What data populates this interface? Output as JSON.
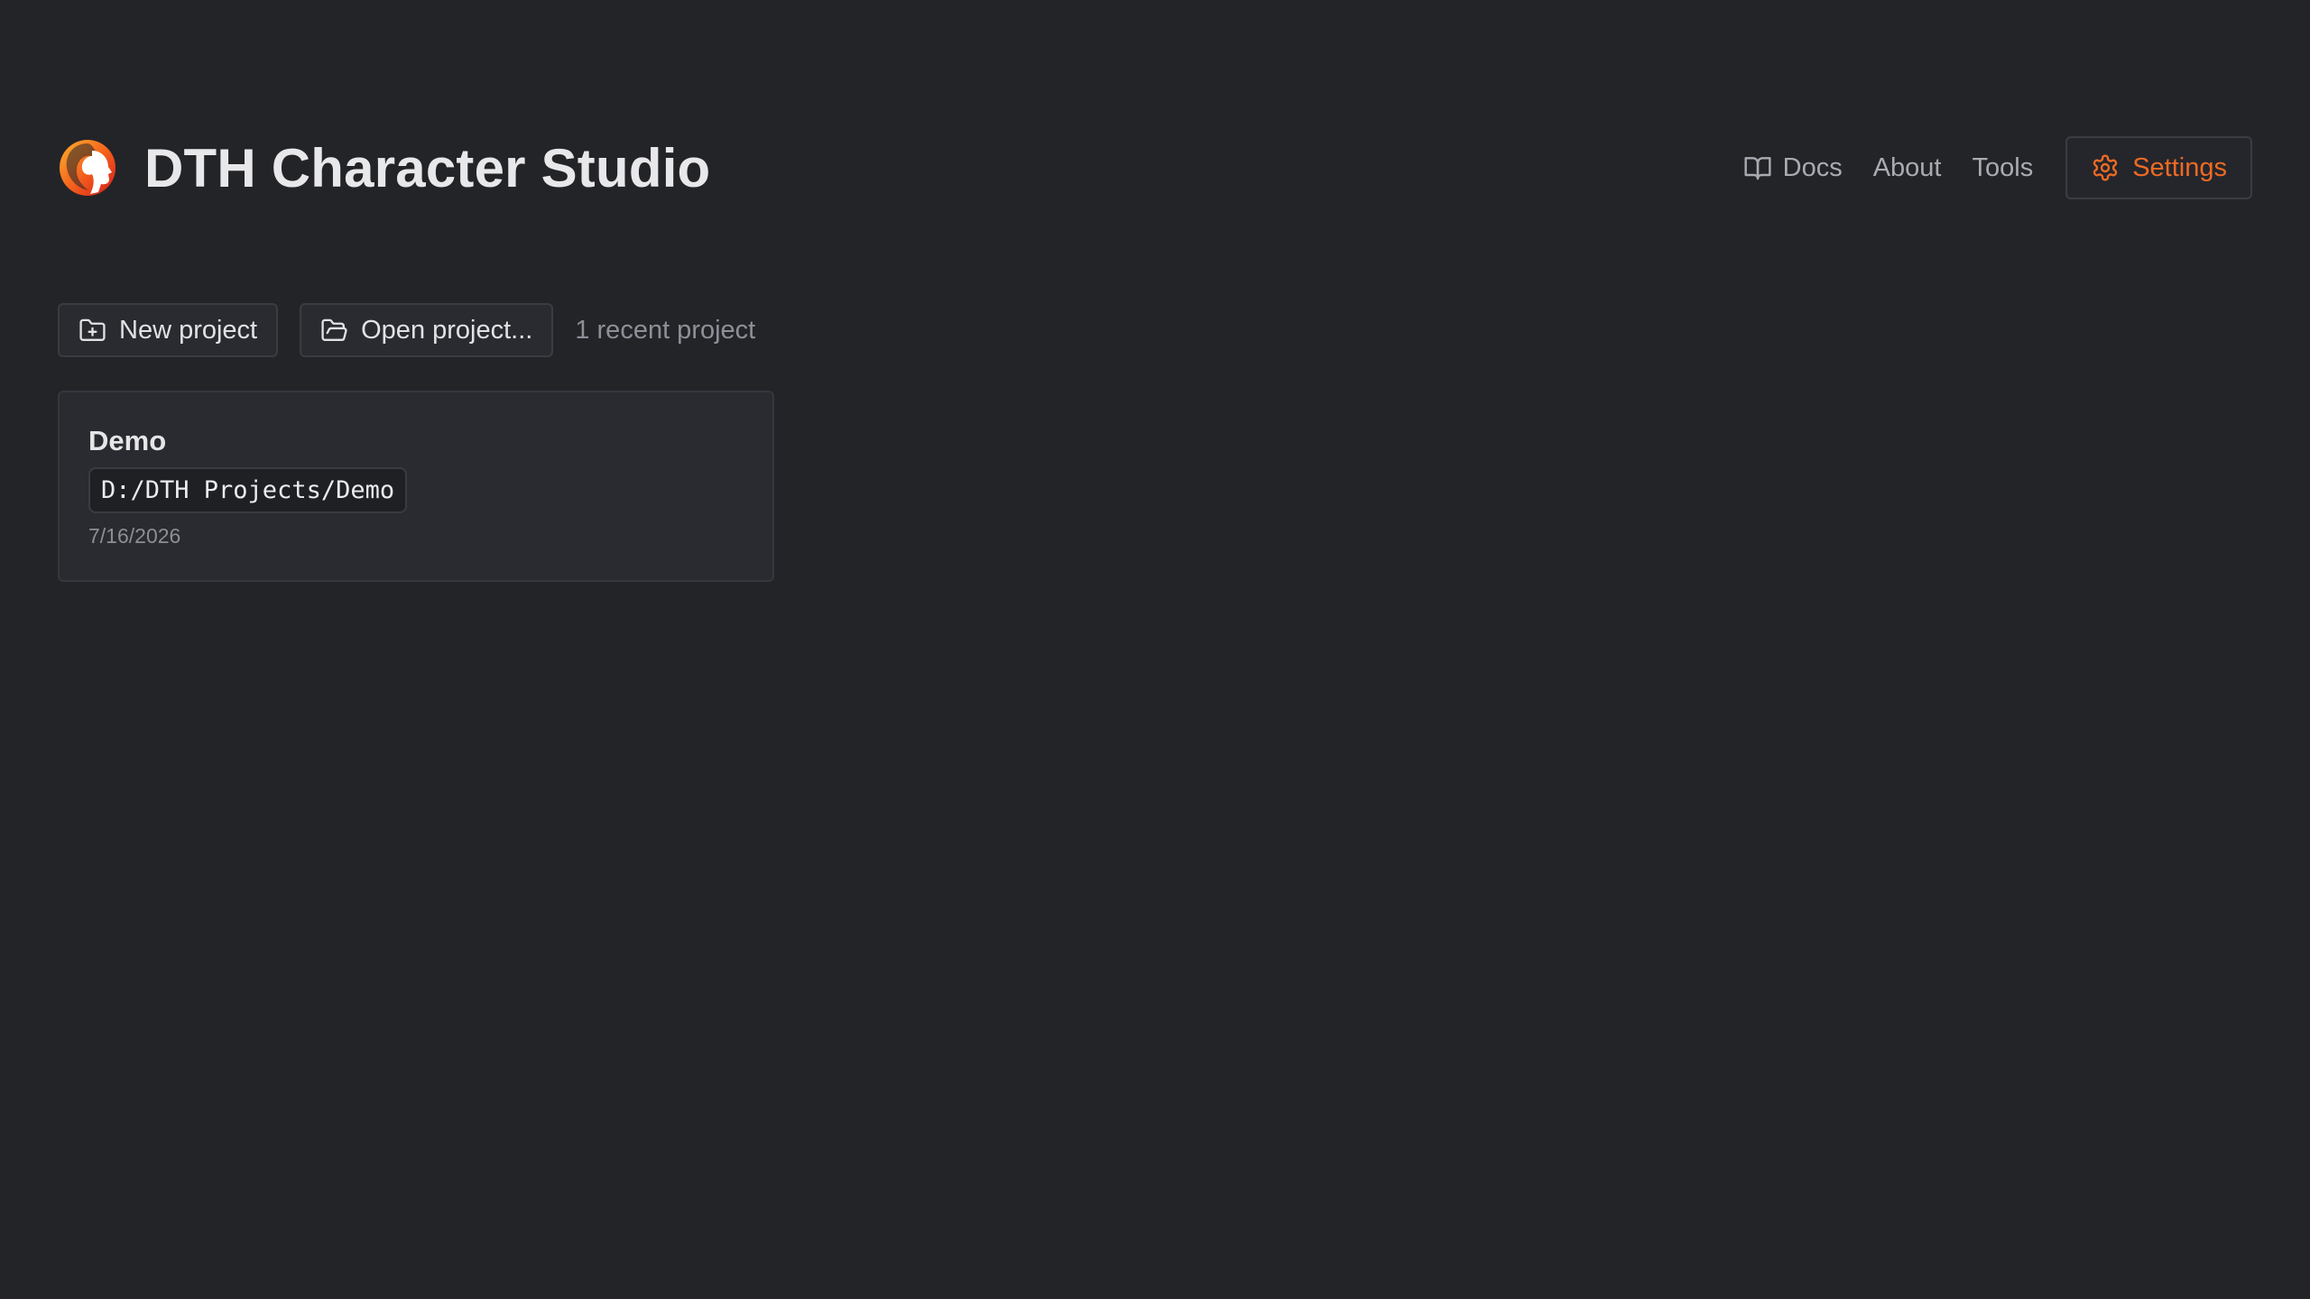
{
  "app": {
    "title": "DTH Character Studio"
  },
  "nav": {
    "docs_label": "Docs",
    "about_label": "About",
    "tools_label": "Tools",
    "settings_label": "Settings"
  },
  "toolbar": {
    "new_project_label": "New project",
    "open_project_label": "Open project...",
    "recent_count_text": "1 recent project"
  },
  "recent_projects": [
    {
      "name": "Demo",
      "path": "D:/DTH Projects/Demo",
      "date": "7/16/2026"
    }
  ],
  "icons": {
    "logo": "dth-logo-icon",
    "docs": "book-open-icon",
    "settings": "gear-icon",
    "new_project": "folder-plus-icon",
    "open_project": "folder-open-icon"
  },
  "colors": {
    "background": "#232428",
    "accent": "#ee6a25",
    "text": "#e6e6e8",
    "muted": "#a9abb2",
    "border": "#3b3c42"
  }
}
